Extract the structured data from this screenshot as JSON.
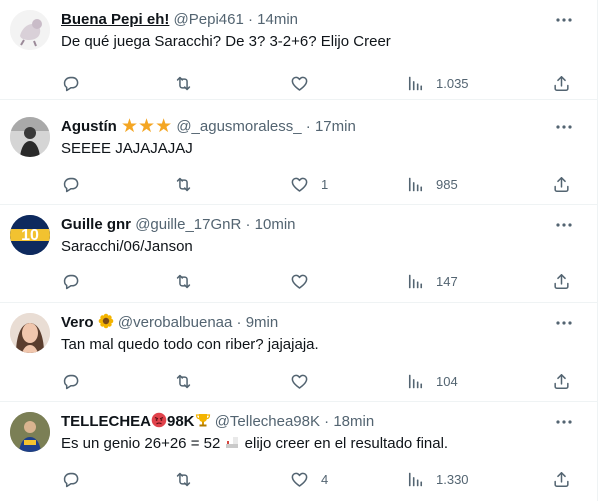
{
  "replies": [
    {
      "name": "Buena Pepi eh!",
      "handle": "@Pepi461",
      "time": "14min",
      "text": "De qué juega Saracchi? De 3? 3-2+6? Elijo Creer",
      "likes": "",
      "views": "1.035"
    },
    {
      "name": "Agustín",
      "handle": "@_agusmoraless_",
      "time": "17min",
      "text": "SEEEE JAJAJAJAJ",
      "likes": "1",
      "views": "985"
    },
    {
      "name": "Guille gnr",
      "handle": "@guille_17GnR",
      "time": "10min",
      "text": "Saracchi/06/Janson",
      "likes": "",
      "views": "147",
      "avatar_text": "10"
    },
    {
      "name": "Vero",
      "handle": "@verobalbuenaa",
      "time": "9min",
      "text": "Tan mal quedo todo con riber?  jajajaja.",
      "likes": "",
      "views": "104"
    },
    {
      "name": "TELLECHEA",
      "name_suffix": "98K",
      "handle": "@Tellechea98K",
      "time": "18min",
      "text_before": "Es un genio 26+26 = 52",
      "text_after": "elijo creer en el resultado final.",
      "likes": "4",
      "views": "1.330"
    }
  ],
  "separator": "·",
  "colors": {
    "text": "#0f1419",
    "secondary": "#536471",
    "border": "#eff3f4",
    "star": "#f4a623"
  },
  "icons": [
    "reply-icon",
    "retweet-icon",
    "like-icon",
    "views-icon",
    "share-icon",
    "more-icon",
    "star-icon",
    "sunflower-icon",
    "angry-face-icon",
    "trophy-icon",
    "flag-icon"
  ]
}
